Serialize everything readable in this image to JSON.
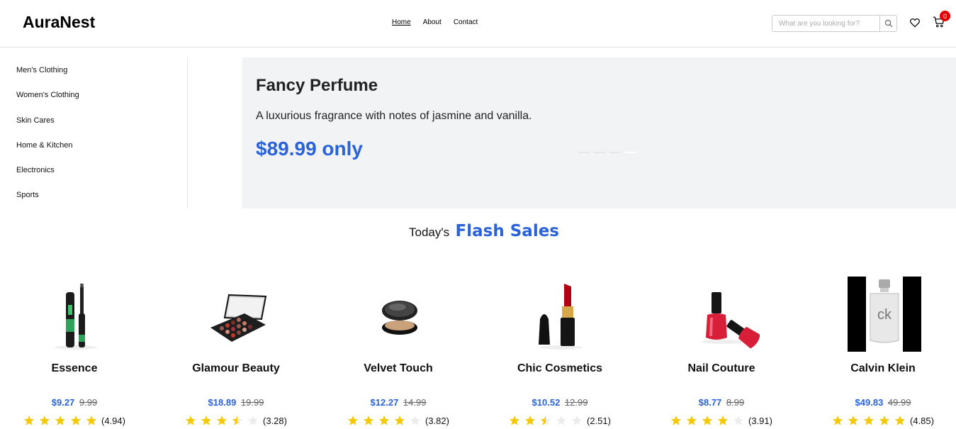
{
  "header": {
    "logo": "AuraNest",
    "nav": [
      "Home",
      "About",
      "Contact"
    ],
    "search_placeholder": "What are you looking for?",
    "cart_count": "0"
  },
  "sidebar": {
    "items": [
      "Men's Clothing",
      "Women's Clothing",
      "Skin Cares",
      "Home & Kitchen",
      "Electronics",
      "Sports"
    ]
  },
  "hero": {
    "title": "Fancy Perfume",
    "description": "A luxurious fragrance with notes of jasmine and vanilla.",
    "price": "$89.99 only"
  },
  "flash": {
    "prefix": "Today's",
    "title": "Flash Sales"
  },
  "products": [
    {
      "name": "Essence",
      "price": "$9.27",
      "old_price": "9.99",
      "rating": 4.94,
      "rating_label": "(4.94)",
      "icon": "mascara-icon"
    },
    {
      "name": "Glamour Beauty",
      "price": "$18.89",
      "old_price": "19.99",
      "rating": 3.28,
      "rating_label": "(3.28)",
      "icon": "eyeshadow-palette-icon"
    },
    {
      "name": "Velvet Touch",
      "price": "$12.27",
      "old_price": "14.99",
      "rating": 3.82,
      "rating_label": "(3.82)",
      "icon": "powder-compact-icon"
    },
    {
      "name": "Chic Cosmetics",
      "price": "$10.52",
      "old_price": "12.99",
      "rating": 2.51,
      "rating_label": "(2.51)",
      "icon": "lipstick-icon"
    },
    {
      "name": "Nail Couture",
      "price": "$8.77",
      "old_price": "8.99",
      "rating": 3.91,
      "rating_label": "(3.91)",
      "icon": "nail-polish-icon"
    },
    {
      "name": "Calvin Klein",
      "price": "$49.83",
      "old_price": "49.99",
      "rating": 4.85,
      "rating_label": "(4.85)",
      "icon": "perfume-bottle-icon"
    }
  ],
  "colors": {
    "accent": "#2a62d9",
    "star": "#f5c800",
    "badge": "#e50000"
  }
}
